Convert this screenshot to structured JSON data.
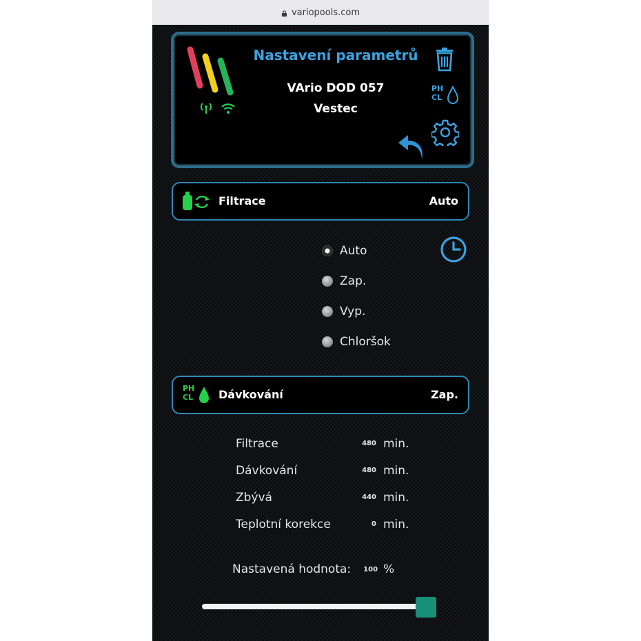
{
  "browser": {
    "url": "variopools.com"
  },
  "header": {
    "title": "Nastavení parametrů",
    "device_name": "VArio DOD 057",
    "location": "Vestec",
    "ph_label": "PH",
    "cl_label": "CL"
  },
  "filtration": {
    "label": "Filtrace",
    "value": "Auto",
    "options": [
      {
        "label": "Auto",
        "selected": true
      },
      {
        "label": "Zap.",
        "selected": false
      },
      {
        "label": "Vyp.",
        "selected": false
      },
      {
        "label": "Chloršok",
        "selected": false
      }
    ]
  },
  "dosing": {
    "label": "Dávkování",
    "value": "Zap.",
    "ph_label": "PH",
    "cl_label": "CL"
  },
  "stats": [
    {
      "label": "Filtrace",
      "value": "480",
      "unit": "min."
    },
    {
      "label": "Dávkování",
      "value": "480",
      "unit": "min."
    },
    {
      "label": "Zbývá",
      "value": "440",
      "unit": "min."
    },
    {
      "label": "Teplotní korekce",
      "value": "0",
      "unit": "min."
    }
  ],
  "setpoint": {
    "label": "Nastavená hodnota:",
    "value": "100",
    "unit": "%",
    "percent": 100
  },
  "colors": {
    "accent": "#3aa3df",
    "frame": "#2f88b7",
    "green": "#27d04a",
    "slider": "#17907a"
  }
}
